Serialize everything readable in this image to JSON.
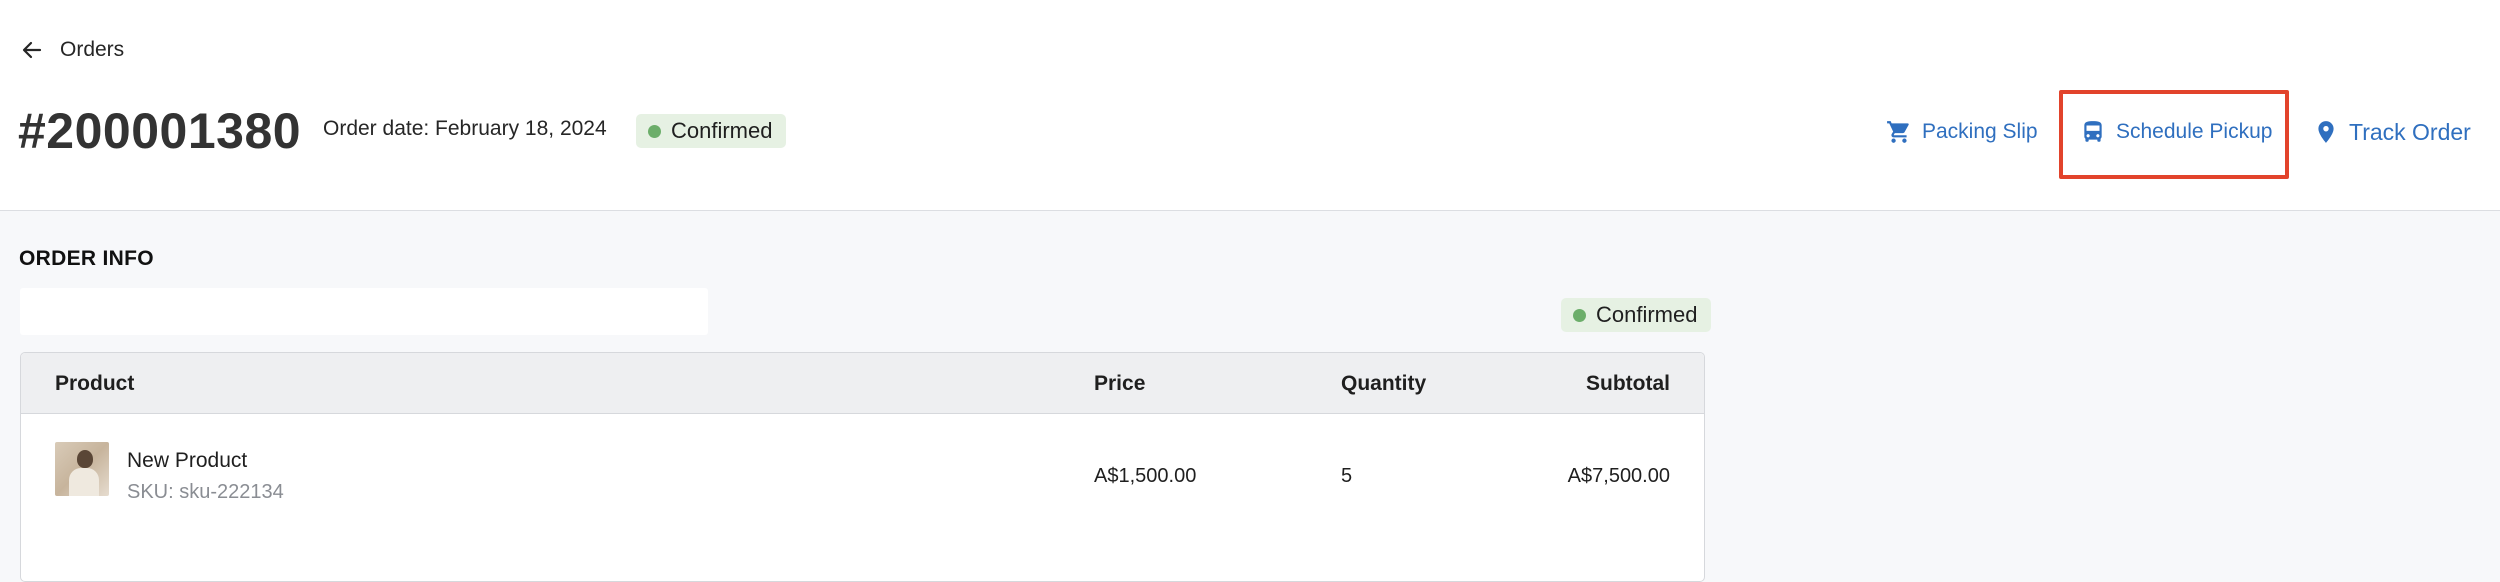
{
  "header": {
    "back_label": "Orders",
    "order_number": "#200001380",
    "order_date": "Order date: February 18, 2024",
    "status": "Confirmed",
    "actions": {
      "packing_slip": "Packing Slip",
      "schedule_pickup": "Schedule Pickup",
      "track_order": "Track Order"
    }
  },
  "order_info": {
    "title": "ORDER INFO",
    "search_value": "",
    "status": "Confirmed",
    "columns": {
      "product": "Product",
      "price": "Price",
      "quantity": "Quantity",
      "subtotal": "Subtotal"
    },
    "rows": [
      {
        "name": "New Product",
        "sku": "SKU: sku-222134",
        "price": "A$1,500.00",
        "quantity": "5",
        "subtotal": "A$7,500.00"
      }
    ]
  },
  "colors": {
    "accent": "#2f6fbf",
    "status_bg": "#e6f1e3",
    "status_dot": "#6cae6a",
    "highlight": "#e2432b"
  },
  "icons": {
    "back": "arrow-left-icon",
    "packing_slip": "cart-icon",
    "schedule_pickup": "truck-icon",
    "track_order": "location-pin-icon"
  }
}
